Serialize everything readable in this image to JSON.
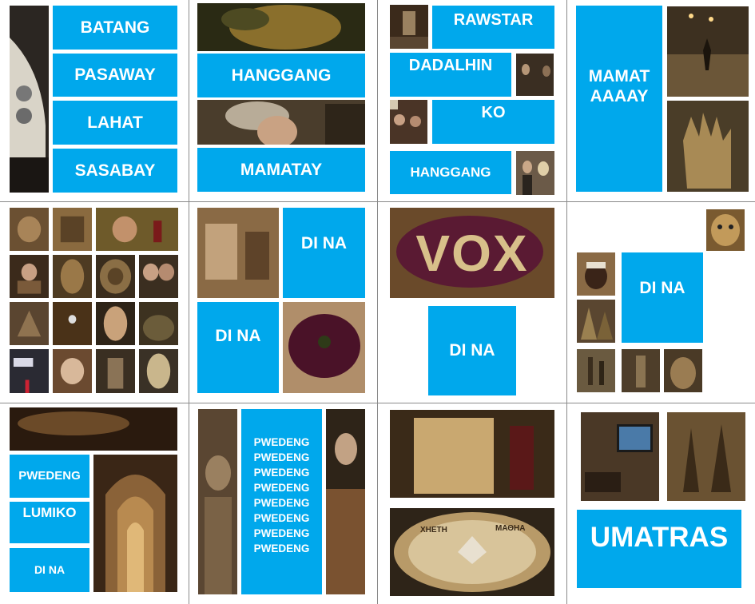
{
  "panels": {
    "p1": [
      "BATANG",
      "PASAWAY",
      "LAHAT",
      "SASABAY"
    ],
    "p2": [
      "HANGGANG",
      "MAMATAY"
    ],
    "p3": [
      "RAWSTAR",
      "DADALHIN",
      "KO",
      "HANGGANG"
    ],
    "p4": [
      "MAMAT",
      "AAAAY"
    ],
    "p6": [
      "DI NA",
      "DI NA"
    ],
    "p7": {
      "sign": "VOX",
      "tile": "DI NA"
    },
    "p8": [
      "DI NA"
    ],
    "p9": [
      "PWEDENG",
      "LUMIKO",
      "DI NA"
    ],
    "p10": [
      "PWEDENG",
      "PWEDENG",
      "PWEDENG",
      "PWEDENG",
      "PWEDENG",
      "PWEDENG",
      "PWEDENG",
      "PWEDENG"
    ],
    "p11": {
      "mosaic_left": "ΧΗΕΤΗ",
      "mosaic_right": "ΜΑΘΗΑ"
    },
    "p12": [
      "UMATRAS"
    ]
  },
  "colors": {
    "tile": "#00a8ec",
    "grid": "#8a8a8a"
  }
}
